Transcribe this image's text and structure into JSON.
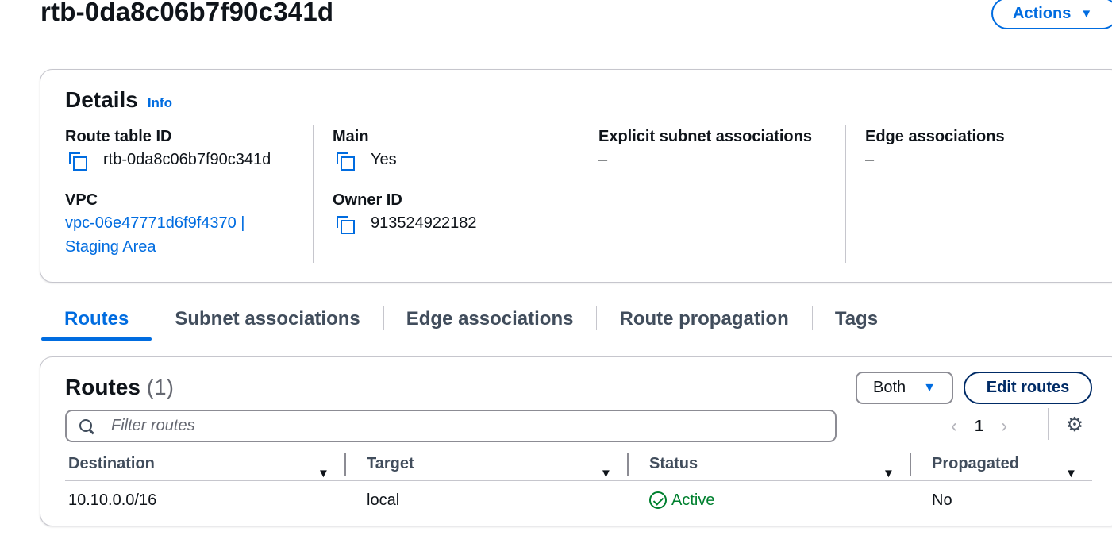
{
  "page": {
    "title": "rtb-0da8c06b7f90c341d",
    "actions_label": "Actions"
  },
  "details": {
    "title": "Details",
    "info_label": "Info",
    "route_table_id_label": "Route table ID",
    "route_table_id_value": "rtb-0da8c06b7f90c341d",
    "vpc_label": "VPC",
    "vpc_value_line1": "vpc-06e47771d6f9f4370 |",
    "vpc_value_line2": "Staging Area",
    "main_label": "Main",
    "main_value": "Yes",
    "owner_id_label": "Owner ID",
    "owner_id_value": "913524922182",
    "explicit_subnet_label": "Explicit subnet associations",
    "explicit_subnet_value": "–",
    "edge_assoc_label": "Edge associations",
    "edge_assoc_value": "–"
  },
  "tabs": [
    {
      "label": "Routes",
      "active": true
    },
    {
      "label": "Subnet associations",
      "active": false
    },
    {
      "label": "Edge associations",
      "active": false
    },
    {
      "label": "Route propagation",
      "active": false
    },
    {
      "label": "Tags",
      "active": false
    }
  ],
  "routes": {
    "title": "Routes",
    "count": "(1)",
    "filter_select_value": "Both",
    "edit_label": "Edit routes",
    "filter_placeholder": "Filter routes",
    "page_number": "1",
    "columns": [
      "Destination",
      "Target",
      "Status",
      "Propagated"
    ],
    "rows": [
      {
        "destination": "10.10.0.0/16",
        "target": "local",
        "status": "Active",
        "propagated": "No"
      }
    ]
  },
  "icons": {
    "copy": "copy-icon",
    "search": "search-icon",
    "settings": "gear-icon",
    "status_ok": "check-circle-icon",
    "caret": "caret-down-icon"
  },
  "colors": {
    "accent": "#006ce0",
    "success": "#00802f",
    "border": "#c6c6cd",
    "text": "#0f141a"
  }
}
